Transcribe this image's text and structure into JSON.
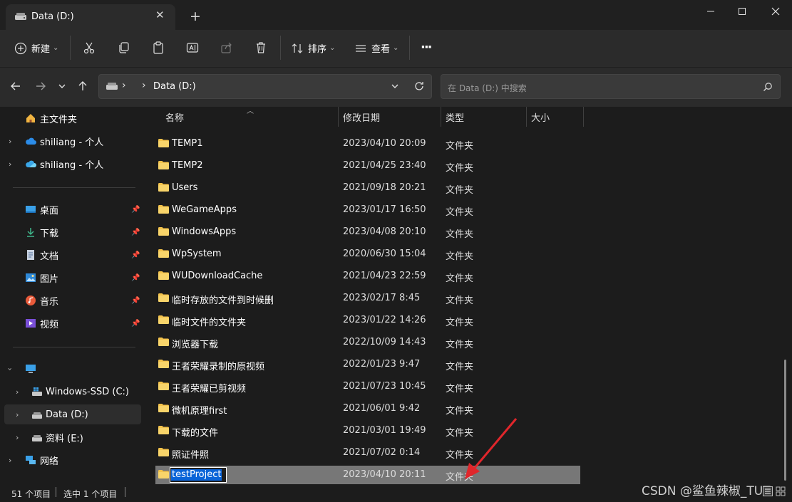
{
  "window": {
    "tab_title": "Data (D:)",
    "tab_close": "✕",
    "new_tab": "+"
  },
  "toolbar": {
    "new_label": "新建",
    "sort_label": "排序",
    "view_label": "查看",
    "more_label": "···",
    "dropdown_glyph": "⌄"
  },
  "address": {
    "path_sep": "›",
    "current": "Data (D:)",
    "search_placeholder": "在 Data (D:) 中搜索"
  },
  "sidebar": {
    "home": "主文件夹",
    "cloud1": "shiliang - 个人",
    "cloud2": "shiliang - 个人",
    "quick": [
      {
        "label": "桌面",
        "icon": "desktop-icon"
      },
      {
        "label": "下载",
        "icon": "download-icon"
      },
      {
        "label": "文档",
        "icon": "document-icon"
      },
      {
        "label": "图片",
        "icon": "picture-icon"
      },
      {
        "label": "音乐",
        "icon": "music-icon"
      },
      {
        "label": "视频",
        "icon": "video-icon"
      }
    ],
    "drives": [
      {
        "label": "Windows-SSD (C:)"
      },
      {
        "label": "Data (D:)"
      },
      {
        "label": "资料 (E:)"
      }
    ],
    "network": "网络"
  },
  "columns": {
    "name": "名称",
    "date": "修改日期",
    "type": "类型",
    "size": "大小"
  },
  "files": [
    {
      "name": "TEMP1",
      "date": "2023/04/10 20:09",
      "type": "文件夹"
    },
    {
      "name": "TEMP2",
      "date": "2021/04/25 23:40",
      "type": "文件夹"
    },
    {
      "name": "Users",
      "date": "2021/09/18 20:21",
      "type": "文件夹"
    },
    {
      "name": "WeGameApps",
      "date": "2023/01/17 16:50",
      "type": "文件夹"
    },
    {
      "name": "WindowsApps",
      "date": "2023/04/08 20:10",
      "type": "文件夹"
    },
    {
      "name": "WpSystem",
      "date": "2020/06/30 15:04",
      "type": "文件夹"
    },
    {
      "name": "WUDownloadCache",
      "date": "2021/04/23 22:59",
      "type": "文件夹"
    },
    {
      "name": "临时存放的文件到时候删",
      "date": "2023/02/17 8:45",
      "type": "文件夹"
    },
    {
      "name": "临时文件的文件夹",
      "date": "2023/01/22 14:26",
      "type": "文件夹"
    },
    {
      "name": "浏览器下载",
      "date": "2022/10/09 14:43",
      "type": "文件夹"
    },
    {
      "name": "王者荣耀录制的原视频",
      "date": "2022/01/23 9:47",
      "type": "文件夹"
    },
    {
      "name": "王者荣耀已剪视频",
      "date": "2021/07/23 10:45",
      "type": "文件夹"
    },
    {
      "name": "微机原理first",
      "date": "2021/06/01 9:42",
      "type": "文件夹"
    },
    {
      "name": "下载的文件",
      "date": "2021/03/01 19:49",
      "type": "文件夹"
    },
    {
      "name": "照证件照",
      "date": "2021/07/02 0:14",
      "type": "文件夹"
    },
    {
      "name": "testProject",
      "date": "2023/04/10 20:11",
      "type": "文件夹"
    }
  ],
  "status": {
    "count": "51 个项目",
    "selected": "选中 1 个项目"
  },
  "watermark": "CSDN @鲨鱼辣椒_TUT",
  "colors": {
    "accent_arrow": "#e0262b",
    "folder": "#f3c24b",
    "selection": "#777777",
    "rename_highlight": "#0a64d8"
  }
}
